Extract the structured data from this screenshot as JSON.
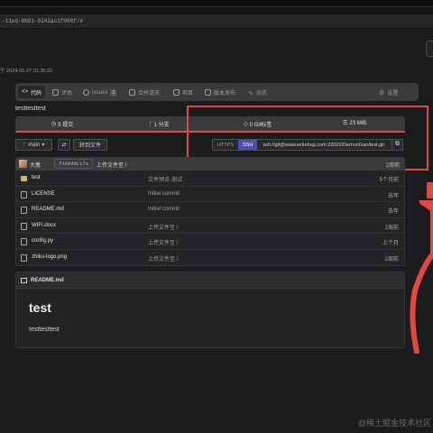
{
  "browser": {
    "url": "-11ed-8b91-0242ac1f000f/#"
  },
  "repo": {
    "date_text": "于 2024-05-27 01:35:22",
    "description": "testtesttest"
  },
  "nav": {
    "tabs": [
      {
        "label": "代码",
        "icon": "code-icon"
      },
      {
        "label": "评估",
        "icon": "review-icon"
      },
      {
        "label": "Issues",
        "icon": "issue-icon",
        "count": "2"
      },
      {
        "label": "合并请求",
        "icon": "merge-request-icon"
      },
      {
        "label": "项目",
        "icon": "project-icon"
      },
      {
        "label": "版本发布",
        "icon": "tag-icon"
      },
      {
        "label": "动态",
        "icon": "activity-icon"
      },
      {
        "label": "设置",
        "icon": "gear-icon"
      }
    ]
  },
  "stats": {
    "commits": "5 提交",
    "branches": "1 分支",
    "tags": "0 Git标签",
    "size": "23 MiB"
  },
  "controls": {
    "branch": "main",
    "goto_file": "转到文件",
    "https_label": "HTTPS",
    "ssh_label": "SSH",
    "clone_url": "ssh://git@www.writebug.com:22022/DemonGan/test.git"
  },
  "last_commit": {
    "user": "大葱",
    "hash": "f369ddc17a",
    "message": "上传文件至 /",
    "time": "2周前"
  },
  "files": [
    {
      "name": "test",
      "type": "folder",
      "message": "文件预览-测试",
      "time": "5个月前"
    },
    {
      "name": "LICENSE",
      "type": "file",
      "message": "Initial commit",
      "time": "去年"
    },
    {
      "name": "README.md",
      "type": "file",
      "message": "Initial commit",
      "time": "去年"
    },
    {
      "name": "WIFI.docx",
      "type": "file",
      "message": "上传文件至 /",
      "time": "2周前"
    },
    {
      "name": "config.py",
      "type": "file",
      "message": "上传文件至 /",
      "time": "上个月"
    },
    {
      "name": "zhiku-logo.png",
      "type": "file",
      "message": "上传文件至 /",
      "time": "2周前"
    }
  ],
  "readme": {
    "label": "README.md",
    "heading": "test",
    "body": "testtesttest"
  },
  "watermark": "@稀土掘金技术社区",
  "colors": {
    "accent_red": "#e2483f",
    "ssh_active": "#4c4fb0"
  }
}
